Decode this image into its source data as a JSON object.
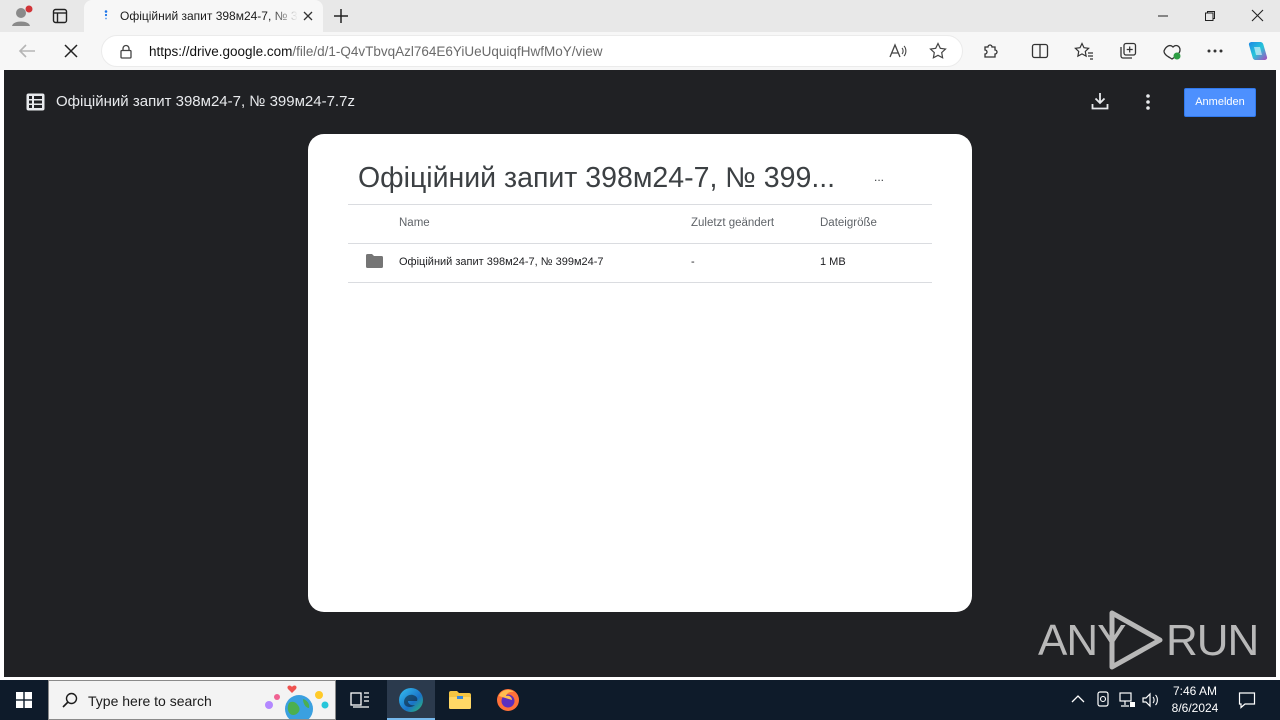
{
  "browser": {
    "tab_title": "Офіційний запит 398м24-7, № 399м24-7.7z",
    "url_domain": "https://drive.google.com",
    "url_path": "/file/d/1-Q4vTbvqAzl764E6YiUeUquiqfHwfMoY/view"
  },
  "viewer": {
    "file_title": "Офіційний запит 398м24-7, № 399м24-7.7z",
    "signin_label": "Anmelden"
  },
  "archive": {
    "title": "Офіційний запит 398м24-7, № 399...",
    "more": "...",
    "columns": {
      "name": "Name",
      "modified": "Zuletzt geändert",
      "size": "Dateigröße"
    },
    "rows": [
      {
        "name": "Офіційний запит 398м24-7, № 399м24-7",
        "modified": "-",
        "size": "1 MB"
      }
    ]
  },
  "watermark": {
    "text_left": "ANY",
    "text_right": "RUN"
  },
  "taskbar": {
    "search_placeholder": "Type here to search",
    "time": "7:46 AM",
    "date": "8/6/2024"
  },
  "colors": {
    "accent_blue": "#4d90fe",
    "viewer_bg": "#202124",
    "taskbar_bg": "#0e1b2a"
  }
}
